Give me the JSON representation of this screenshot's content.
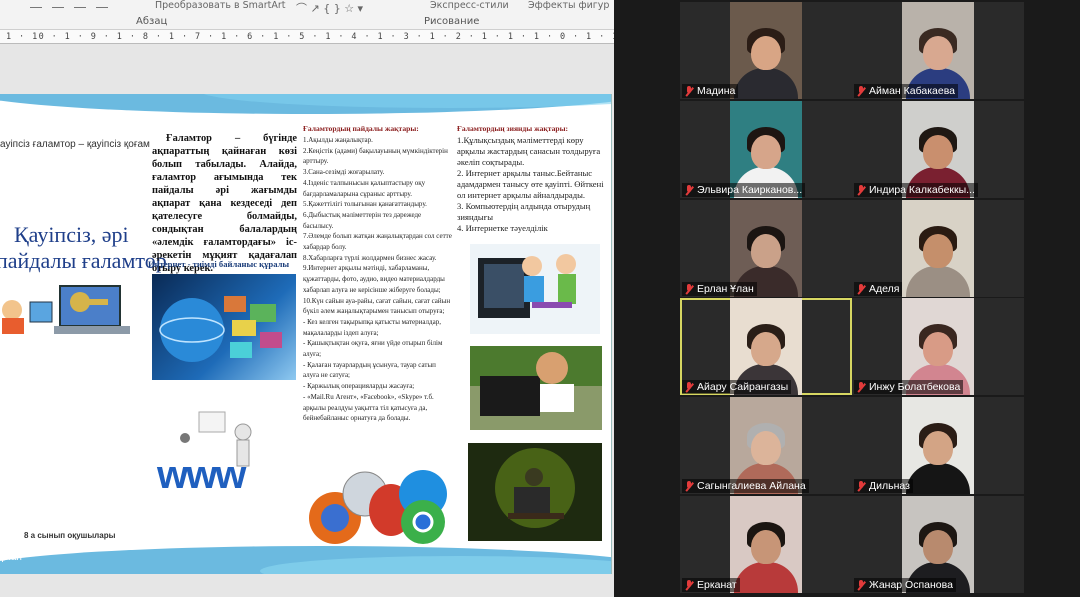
{
  "ribbon": {
    "group_paragraph": "Абзац",
    "group_drawing": "Рисование",
    "convert_smartart": "Преобразовать в SmartArt",
    "effects": "Эффекты фигур",
    "quick_styles": "Экспресс-стили"
  },
  "ruler_text": "1 · 10 · 1 · 9 · 1 · 8 · 1 · 7 · 1 · 6 · 1 · 5 · 1 · 4 · 1 · 3 · 1 · 2 · 1 · 1 · 1 · 0 · 1 · 1 · 1 · 2 · 1 · 3 · 1 · 4 · 1 · 5 · 1 · 6 · 1 · 7 · 1 · 8 · 1 · 9 · 1 · 10 · 1 · 11 · 1 · 12 ·",
  "slide": {
    "col1_top": "ауіпсіз ғаламтор – қауіпсіз қоғам",
    "col1_title_1": "Қауіпсіз, әрі",
    "col1_title_2": "пайдалы ғаламтор",
    "col1_bottom": "8 а сынып оқушылары",
    "col1_bottom2": "ұлан",
    "col2_paragraph": "Ғаламтор – бүгінде ақпараттың қайнаған көзі болып табылады. Алайда, ғаламтор ағымында тек пайдалы әрі жағымды ақпарат қана кездеседі деп қателесуге болмайды, сондықтан балалардың «әлемдік ғаламтордағы» іс-әрекетін мұқият қадағалап отыру керек.",
    "col2_caption": "Интернет - тиімді байланыс құралы",
    "col3_title": "Ғаламтордың пайдалы жақтары:",
    "col3_text": "1.Ақылды жаңалықтар.\n2.Кеңістік (адами) бақылауының мүмкіндіктерін арттыру.\n3.Сана-сезімді жоғарылату.\n4.Ізденіс талпынысын қалыптастыру оқу бағдарламаларына сұраныс арттыру.\n5.Қажеттілігі толығынан қанағаттандыру.\n6.Дыбыстық мәліметтерін тез дәрежеде басылысу.\n7.Әлемде болып жатқан жаңалықтардан сол сетте хабардар болу.\n8.Хабарларға түрлі жолдармен бизнес жасау.\n9.Интернет арқылы мәтінді, хабарламаны, құжаттарды, фото, аудио, видео материалдарды\nхабарлап алуға не керісінше жіберуге болады;\n10.Күн сайын ауа-райы, сағат сайын, сағат сайын бүкіл әлем жаңалықтарымен танысып отыруға;\n- Кез келген тақырыпқа қатысты материалдар, мақалаларды іздеп алуға;\n- Қашықтықтан оқуға, яғни үйде отырып білім алуға;\n- Қалаған тауарлардың ұсынуға, тауар сатып алуға не сатуға;\n- Қаржылық операцияларды жасауға;\n- «Mail.Ru Агент», «Facebook», «Skype» т.б. арқылы реалдуы уақытта тіл қатысуға да, бейнебайланыс орнатуға да болады.",
    "col4_title": "Ғаламтордың зиянды жақтары:",
    "col4_text": "1.Құлықсыздық мәліметтерді көру арқылы жастардың санасын толдыруға әкеліп соқтырады.\n2. Интернет арқылы таныс.Бейтаныс адамдармен танысу өте қауіпті. Өйткені ол интернет арқылы айналдырады.\n3. Компьютердің алдында отырудың зияндығы\n4. Интернетке тәуелділік"
  },
  "participants": [
    {
      "name": "Мадина",
      "col": 0,
      "row": 0,
      "active": false,
      "bg": "#6b5a4c",
      "skin": "#d8a585",
      "hair": "#2b1d16",
      "shirt": "#2a2a30"
    },
    {
      "name": "Айман Кабакаева",
      "col": 1,
      "row": 0,
      "active": false,
      "bg": "#b9b2aa",
      "skin": "#d8a890",
      "hair": "#3a2a22",
      "shirt": "#2b3d80"
    },
    {
      "name": "Эльвира Каирканов...",
      "col": 0,
      "row": 1,
      "active": false,
      "bg": "#2f7f82",
      "skin": "#d6a58a",
      "hair": "#1d1512",
      "shirt": "#f2f2f2"
    },
    {
      "name": "Индира Калкабеккы...",
      "col": 1,
      "row": 1,
      "active": false,
      "bg": "#cfcfcc",
      "skin": "#c98f6e",
      "hair": "#1f1813",
      "shirt": "#7a2030"
    },
    {
      "name": "Ерлан Ұлан",
      "col": 0,
      "row": 2,
      "active": false,
      "bg": "#6e5d55",
      "skin": "#caa189",
      "hair": "#1b1512",
      "shirt": "#3a2b2a"
    },
    {
      "name": "Аделя",
      "col": 1,
      "row": 2,
      "active": false,
      "bg": "#d8d2c6",
      "skin": "#c58f6b",
      "hair": "#2a1b12",
      "shirt": "#9b8f84"
    },
    {
      "name": "Айару Сайрангазы",
      "col": 0,
      "row": 3,
      "active": true,
      "bg": "#e8ddd0",
      "skin": "#d6a88b",
      "hair": "#2a1e17",
      "shirt": "#3b3538"
    },
    {
      "name": "Инжу Болатбекова",
      "col": 1,
      "row": 3,
      "active": false,
      "bg": "#e0d7d4",
      "skin": "#d89b86",
      "hair": "#3a2720",
      "shirt": "#d28590"
    },
    {
      "name": "Сагынгалиева Айлана",
      "col": 0,
      "row": 4,
      "active": false,
      "bg": "#b8a89c",
      "skin": "#dcb49a",
      "hair": "#b0b0b0",
      "shirt": "#b06a5a"
    },
    {
      "name": "Дильназ",
      "col": 1,
      "row": 4,
      "active": false,
      "bg": "#e7e7e3",
      "skin": "#d3a485",
      "hair": "#2b1d16",
      "shirt": "#151515"
    },
    {
      "name": "Ерканат",
      "col": 0,
      "row": 5,
      "active": false,
      "bg": "#d9c9c4",
      "skin": "#c79577",
      "hair": "#1b1511",
      "shirt": "#b83a3a"
    },
    {
      "name": "Жанар Оспанова",
      "col": 1,
      "row": 5,
      "active": false,
      "bg": "#c7c4c0",
      "skin": "#b88a6e",
      "hair": "#1d1713",
      "shirt": "#1d1d20"
    }
  ]
}
